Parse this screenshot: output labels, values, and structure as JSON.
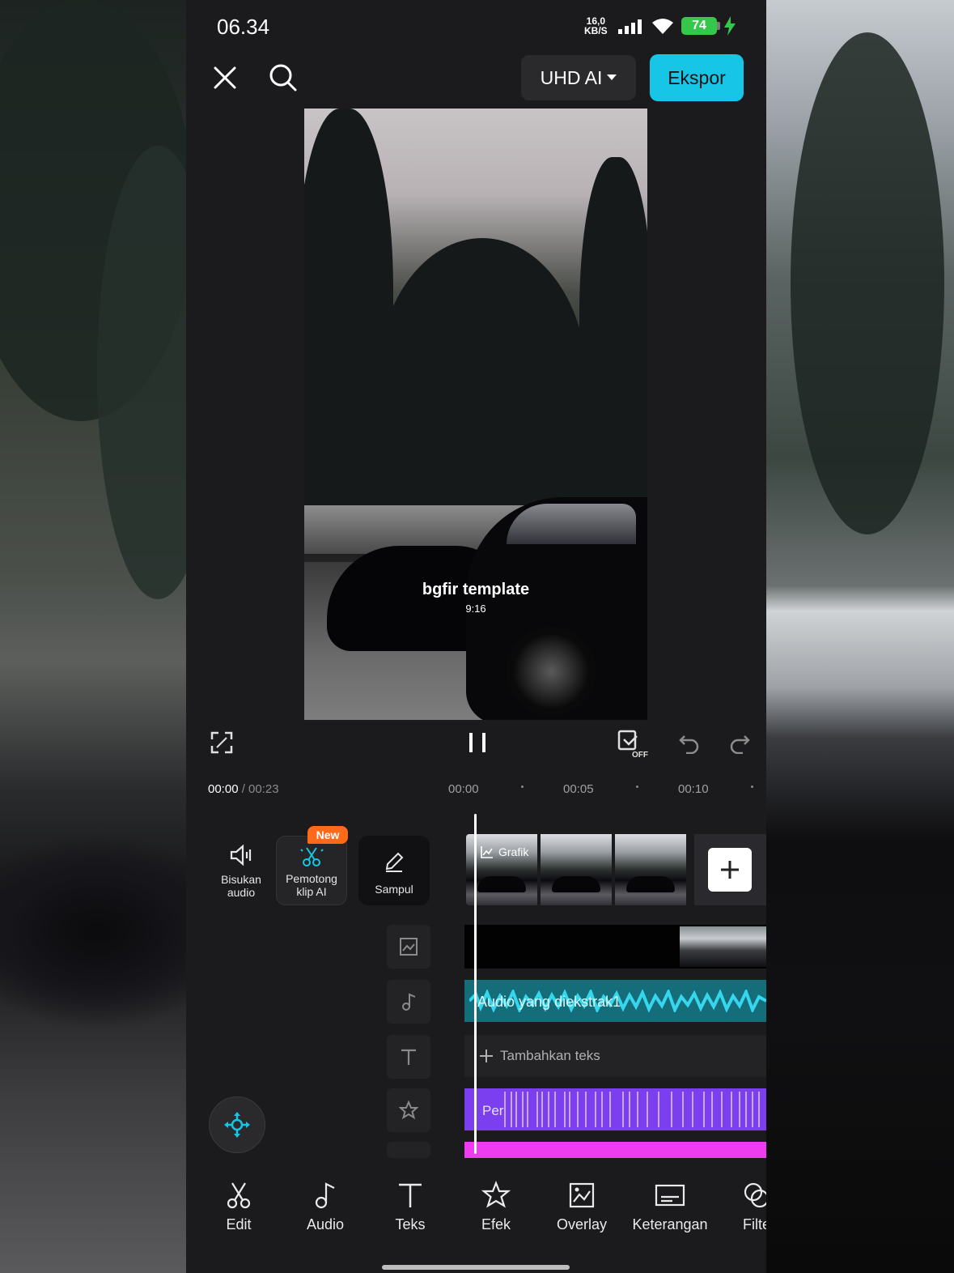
{
  "status": {
    "time": "06.34",
    "speed_value": "16,0",
    "speed_unit": "KB/S",
    "battery": "74"
  },
  "topbar": {
    "quality_label": "UHD AI",
    "export_label": "Ekspor"
  },
  "preview": {
    "title": "bgfir template",
    "ratio": "9:16"
  },
  "timeline": {
    "current_time": "00:00",
    "total_time": "/ 00:23",
    "ticks": [
      "00:00",
      "00:05",
      "00:10"
    ]
  },
  "tools": {
    "mute_label": "Bisukan audio",
    "ai_cut_label": "Pemotong klip AI",
    "new_badge": "New",
    "cover_label": "Sampul"
  },
  "tracks": {
    "video_label": "Grafik",
    "audio_label": "Audio yang diekstrak1",
    "text_add_label": "Tambahkan teks",
    "effect_label": "Per"
  },
  "nav": {
    "items": [
      {
        "label": "Edit"
      },
      {
        "label": "Audio"
      },
      {
        "label": "Teks"
      },
      {
        "label": "Efek"
      },
      {
        "label": "Overlay"
      },
      {
        "label": "Keterangan"
      },
      {
        "label": "Filte"
      }
    ]
  },
  "colors": {
    "accent": "#17c6e6",
    "audio": "#156d7a",
    "effect": "#7b3ff0",
    "badge": "#ff6a1a"
  }
}
